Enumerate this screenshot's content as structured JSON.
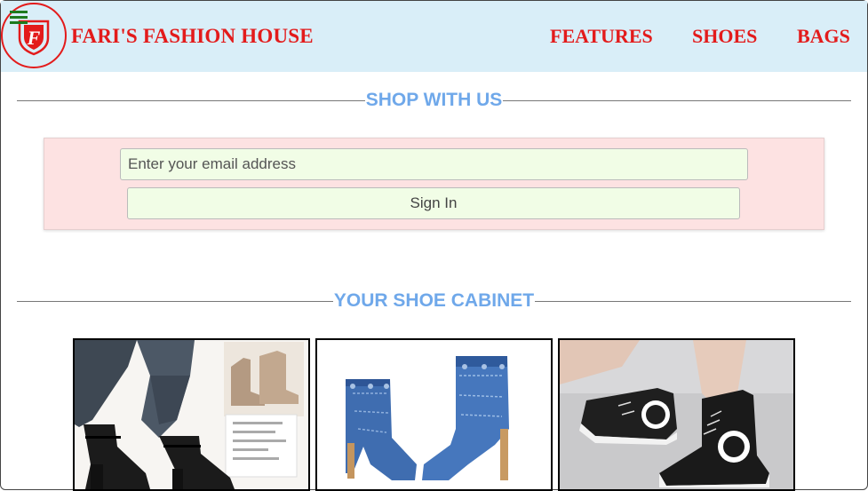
{
  "header": {
    "brand": "FARI'S FASHION HOUSE",
    "logo_letter": "F",
    "nav": [
      {
        "label": "FEATURES"
      },
      {
        "label": "SHOES"
      },
      {
        "label": "BAGS"
      }
    ]
  },
  "sections": {
    "shop": {
      "title": "SHOP WITH US"
    },
    "cabinet": {
      "title": "YOUR SHOE CABINET"
    }
  },
  "signin": {
    "email_placeholder": "Enter your email address",
    "button_label": "Sign In"
  },
  "shoes": [
    {
      "icon": "black-suede-ankle-boots-icon"
    },
    {
      "icon": "denim-stiletto-ankle-boots-icon"
    },
    {
      "icon": "black-high-top-sneakers-icon"
    }
  ],
  "colors": {
    "header_bg": "#d9eef8",
    "brand_red": "#e31b1b",
    "heading_blue": "#6fa8ea",
    "panel_pink": "#fde2e2",
    "input_green": "#f1fde6",
    "menu_green": "#1e7a1e"
  }
}
